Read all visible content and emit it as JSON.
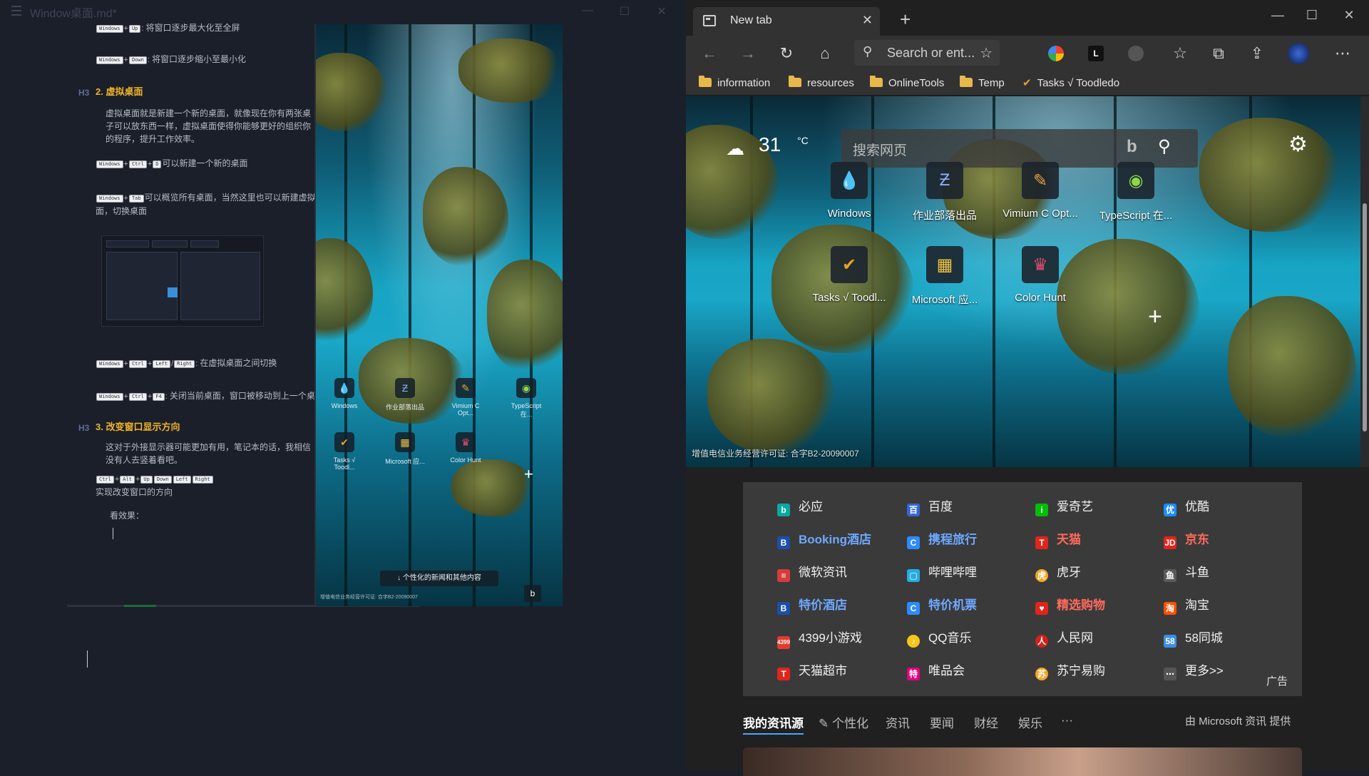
{
  "editor": {
    "title": "Window桌面.md*",
    "lines": {
      "l1_tail": "将窗口逐步最大化至全屏",
      "l2_tail": "将窗口逐步缩小至最小化",
      "h3_tag": "H3",
      "h3_virtual": "2. 虚拟桌面",
      "virtual_desc": "虚拟桌面就是新建一个新的桌面，就像现在你有两张桌子可以放东西一样，虚拟桌面使得你能够更好的组织你的程序，提升工作效率。",
      "ctrl_d_tail": "可以新建一个新的桌面",
      "tab_tail": "可以概览所有桌面，当然这里也可以新建虚拟桌面，切换桌面",
      "switch_tail": "在虚拟桌面之间切换",
      "close_tail": "关闭当前桌面，窗口被移动到上一个桌面",
      "h3_orient": "3. 改变窗口显示方向",
      "orient_desc": "这对于外接显示器可能更加有用，笔记本的话，我相信没有人去竖着看吧。",
      "orient_tail": "实现改变窗口的方向",
      "effect": "看效果："
    },
    "keys": {
      "windows": "Windows",
      "up": "Up",
      "down": "Down",
      "ctrl": "Ctrl",
      "d": "D",
      "tab": "Tab",
      "left": "Left",
      "right": "Right",
      "f4": "F4",
      "alt": "Alt"
    }
  },
  "preview": {
    "tiles": [
      "Windows",
      "作业部落出品",
      "Vimium C Opt...",
      "TypeScript 在...",
      "Tasks √ Toodl...",
      "Microsoft 应...",
      "Color Hunt"
    ],
    "news_button": "↓ 个性化的新闻和其他内容",
    "license": "增值电信业务经营许可证: 合字B2-20090007"
  },
  "browser": {
    "tab_title": "New tab",
    "address_placeholder": "Search or ent...",
    "favorites": [
      "information",
      "resources",
      "OnlineTools",
      "Temp",
      "Tasks √ Toodledo"
    ],
    "weather_temp": "31",
    "weather_unit": "°C",
    "search_placeholder": "搜索网页",
    "tiles": [
      "Windows",
      "作业部落出品",
      "Vimium C Opt...",
      "TypeScript 在...",
      "Tasks √ Toodl...",
      "Microsoft 应...",
      "Color Hunt"
    ],
    "license": "增值电信业务经营许可证: 合字B2-20090007",
    "quick_links": [
      [
        "必应",
        "百度",
        "爱奇艺",
        "优酷"
      ],
      [
        "Booking酒店",
        "携程旅行",
        "天猫",
        "京东"
      ],
      [
        "微软资讯",
        "哔哩哔哩",
        "虎牙",
        "斗鱼"
      ],
      [
        "特价酒店",
        "特价机票",
        "精选购物",
        "淘宝"
      ],
      [
        "4399小游戏",
        "QQ音乐",
        "人民网",
        "58同城"
      ],
      [
        "天猫超市",
        "唯品会",
        "苏宁易购",
        "更多>>"
      ]
    ],
    "ad_label": "广告",
    "feed_tabs": [
      "我的资讯源",
      "个性化",
      "资讯",
      "要闻",
      "财经",
      "娱乐",
      "···"
    ],
    "provider": "由 Microsoft 资讯 提供",
    "colors": {
      "accent": "#4aa6ff",
      "heading": "#f0b429"
    }
  }
}
